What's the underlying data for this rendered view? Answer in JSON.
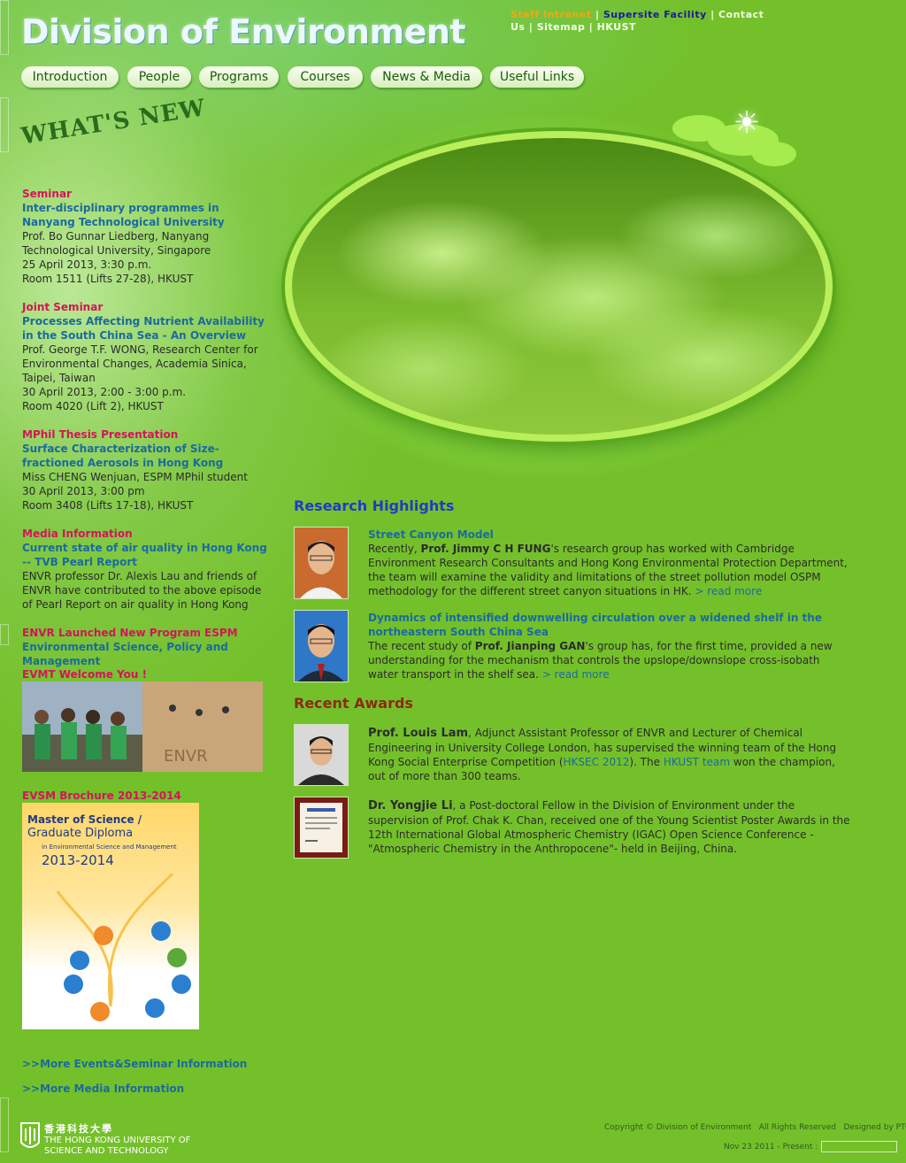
{
  "header": {
    "site_title": "Division of Environment",
    "top_links": [
      {
        "label": "Staff Intranet"
      },
      {
        "label": "Supersite Facility"
      },
      {
        "label": "Contact Us"
      },
      {
        "label": "Sitemap"
      },
      {
        "label": "HKUST"
      }
    ],
    "top_links_sep": "|"
  },
  "nav": {
    "items": [
      {
        "label": "Introduction"
      },
      {
        "label": "People"
      },
      {
        "label": "Programs"
      },
      {
        "label": "Courses"
      },
      {
        "label": "News & Media"
      },
      {
        "label": "Useful Links"
      }
    ]
  },
  "whats_new": {
    "heading": "WHAT'S NEW",
    "items": [
      {
        "category": "Seminar",
        "title": "Inter-disciplinary programmes in Nanyang Technological University",
        "lines": [
          "Prof. Bo Gunnar Liedberg, Nanyang Technological University, Singapore",
          "25 April 2013, 3:30 p.m.",
          "Room 1511 (Lifts 27-28), HKUST"
        ]
      },
      {
        "category": "Joint Seminar",
        "title": "Processes Affecting Nutrient Availability in the South China Sea - An Overview",
        "lines": [
          "Prof. George T.F. WONG, Research Center for Environmental Changes, Academia Sinica, Taipei, Taiwan",
          "30 April 2013, 2:00 - 3:00 p.m.",
          "Room 4020 (Lift 2), HKUST"
        ]
      },
      {
        "category": "MPhil Thesis Presentation",
        "title": "Surface Characterization of Size-fractioned Aerosols in Hong Kong",
        "lines": [
          "Miss CHENG Wenjuan, ESPM MPhil student",
          "30 April 2013, 3:00 pm",
          "Room 3408 (Lifts 17-18), HKUST"
        ]
      },
      {
        "category": "Media Information",
        "title": "Current state of air quality in Hong Kong -- TVB Pearl Report",
        "lines": [
          "ENVR professor Dr. Alexis Lau and friends of ENVR have contributed to the above episode of Pearl Report on air quality in Hong Kong"
        ]
      },
      {
        "category": "ENVR Launched New Program ESPM",
        "title": "Environmental Science, Policy and Management",
        "lines": []
      }
    ],
    "evmt_label": "EVMT Welcome You !",
    "evsm_label": "EVSM Brochure 2013-2014",
    "brochure": {
      "line1": "Master of Science /",
      "line2": "Graduate Diploma",
      "line3": "in Environmental Science and Management",
      "year": "2013-2014"
    },
    "more_events": ">>More Events&Seminar Information",
    "more_media": ">>More Media Information"
  },
  "research": {
    "heading": "Research Highlights",
    "items": [
      {
        "title": "Street Canyon Model",
        "pre": "Recently, ",
        "person": "Prof. Jimmy C H FUNG",
        "post": "'s research group has worked with Cambridge Environment Research Consultants and Hong Kong Environmental Protection Department, the team will examine the validity and limitations of the street pollution model OSPM methodology for the different street canyon situations in HK.",
        "more": "> read more"
      },
      {
        "title": "Dynamics of intensified downwelling circulation over a widened shelf in the northeastern South China Sea",
        "pre": "The recent study of ",
        "person": "Prof. Jianping GAN",
        "post": "'s group has, for the first time, provided a new understanding for the mechanism that controls the upslope/downslope cross-isobath water transport in the shelf sea.",
        "more": "> read more"
      }
    ]
  },
  "awards": {
    "heading": "Recent Awards",
    "items": [
      {
        "name": "Prof. Louis Lam",
        "text1": ", Adjunct Assistant Professor of ENVR and Lecturer of Chemical Engineering in University College London, has supervised the winning team of the Hong Kong Social Enterprise Competition (",
        "link1": "HKSEC 2012",
        "text2": "). The ",
        "link2": "HKUST team",
        "text3": " won the champion, out of more than 300 teams."
      },
      {
        "name": "Dr. Yongjie Li",
        "text1": ", a Post-doctoral Fellow in the Division of Environment under the supervision of Prof. Chak K. Chan, received one of the Young Scientist Poster Awards in the 12th International Global Atmospheric Chemistry (IGAC) Open Science Conference -\"Atmospheric Chemistry in the Anthropocene\"- held in Beijing, China."
      }
    ]
  },
  "footer": {
    "copyright": "Copyright © Division of Environment   All Rights Reserved   Designed by PTC",
    "counter_label": "Nov 23 2011 - Present :",
    "logo_chinese": "香港科技大學",
    "logo_line1": "THE HONG KONG UNIVERSITY OF",
    "logo_line2": "SCIENCE AND TECHNOLOGY"
  }
}
